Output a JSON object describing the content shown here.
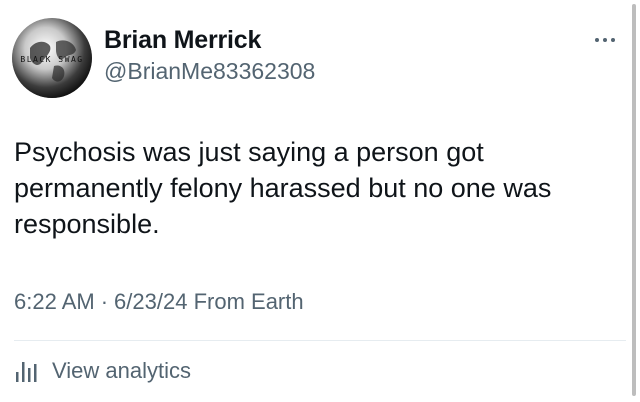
{
  "author": {
    "display_name": "Brian Merrick",
    "handle": "@BrianMe83362308",
    "avatar_text": "BLACK SWAG"
  },
  "tweet": {
    "text": "Psychosis was just saying a person got permanently felony harassed but no one was responsible.",
    "time": "6:22 AM",
    "separator": "·",
    "date": "6/23/24",
    "source": "From Earth"
  },
  "analytics": {
    "label": "View analytics",
    "icon": "bar-chart-icon"
  },
  "icons": {
    "more": "more-options-icon",
    "avatar": "globe-avatar"
  },
  "colors": {
    "text_primary": "#0f1419",
    "text_secondary": "#536471",
    "divider": "#e6ecf0"
  }
}
